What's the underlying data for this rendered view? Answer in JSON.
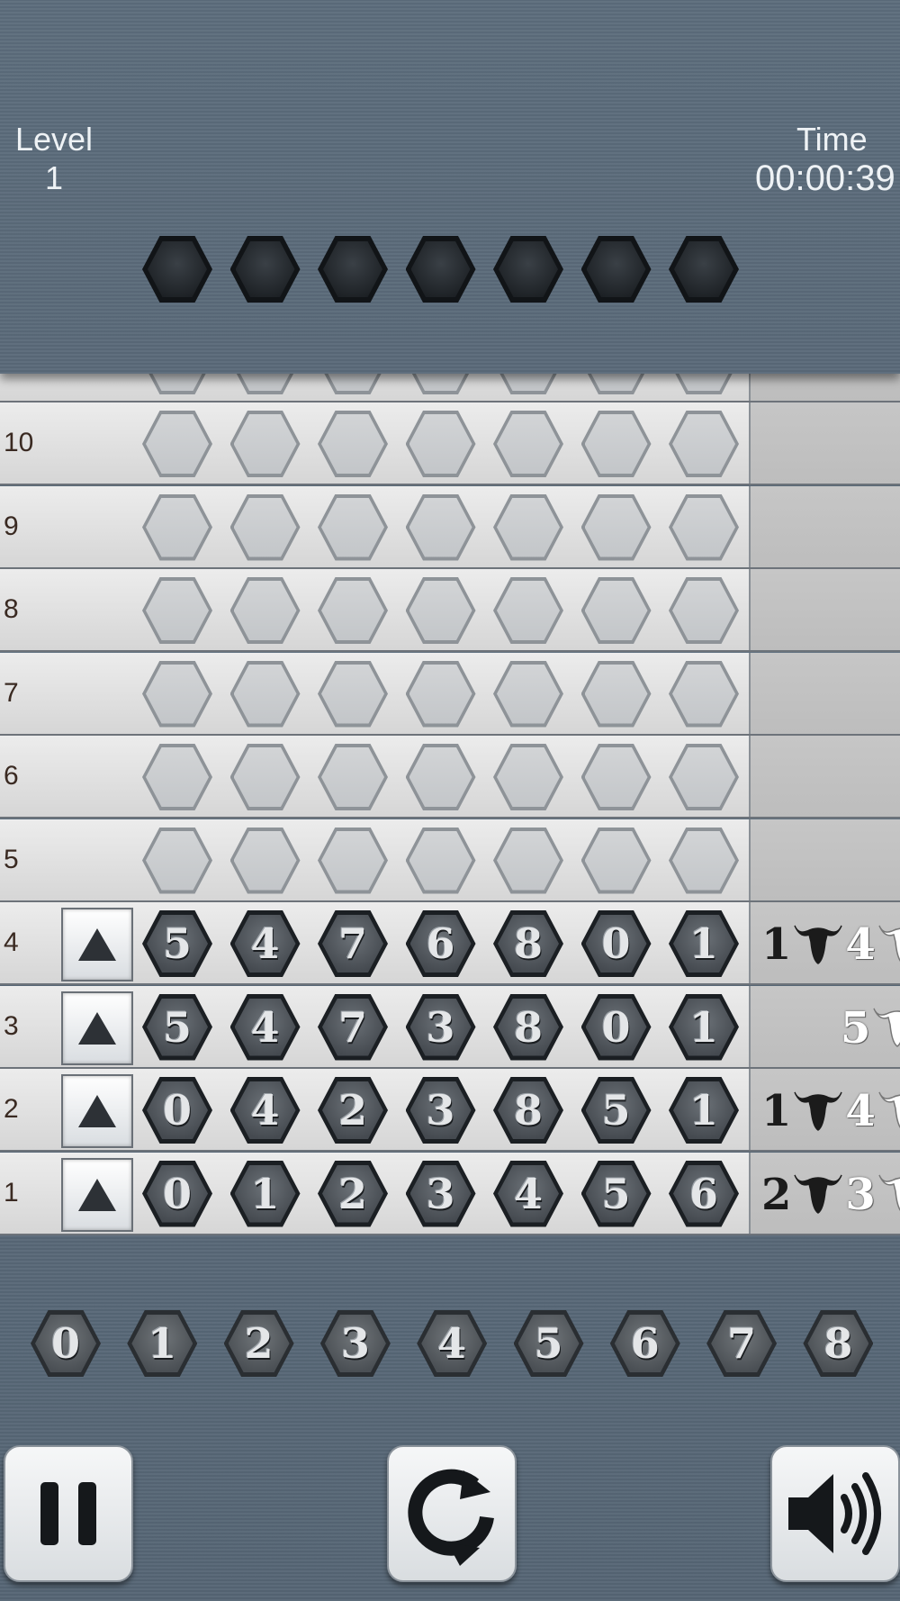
{
  "header": {
    "level_label": "Level",
    "level_value": "1",
    "time_label": "Time",
    "time_value": "00:00:39"
  },
  "secret_slots": 7,
  "rows": [
    {
      "label": "10",
      "digits": null,
      "bulls": null,
      "cows": null
    },
    {
      "label": "9",
      "digits": null,
      "bulls": null,
      "cows": null
    },
    {
      "label": "8",
      "digits": null,
      "bulls": null,
      "cows": null
    },
    {
      "label": "7",
      "digits": null,
      "bulls": null,
      "cows": null
    },
    {
      "label": "6",
      "digits": null,
      "bulls": null,
      "cows": null
    },
    {
      "label": "5",
      "digits": null,
      "bulls": null,
      "cows": null
    },
    {
      "label": "4",
      "digits": [
        "5",
        "4",
        "7",
        "6",
        "8",
        "0",
        "1"
      ],
      "bulls": "1",
      "cows": "4"
    },
    {
      "label": "3",
      "digits": [
        "5",
        "4",
        "7",
        "3",
        "8",
        "0",
        "1"
      ],
      "bulls": null,
      "cows": "5"
    },
    {
      "label": "2",
      "digits": [
        "0",
        "4",
        "2",
        "3",
        "8",
        "5",
        "1"
      ],
      "bulls": "1",
      "cows": "4"
    },
    {
      "label": "1",
      "digits": [
        "0",
        "1",
        "2",
        "3",
        "4",
        "5",
        "6"
      ],
      "bulls": "2",
      "cows": "3"
    }
  ],
  "keypad": [
    "0",
    "1",
    "2",
    "3",
    "4",
    "5",
    "6",
    "7",
    "8"
  ],
  "controls": {
    "pause_icon": "pause-icon",
    "restart_icon": "restart-icon",
    "sound_icon": "speaker-icon"
  }
}
